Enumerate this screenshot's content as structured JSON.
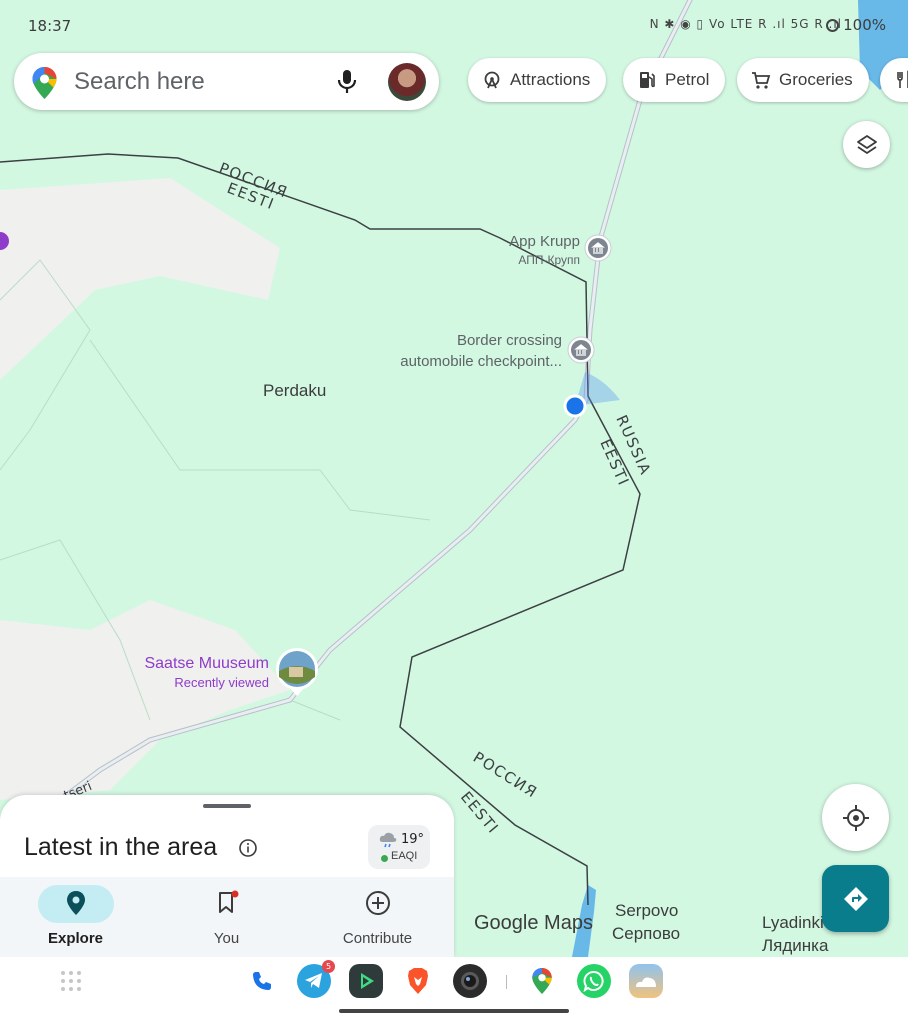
{
  "status_bar": {
    "time": "18:37",
    "icons_text": "N ✱ ◉ ▯ Vo LTE R .ıl 5G R .ıl",
    "battery": "100%"
  },
  "search": {
    "placeholder": "Search here"
  },
  "chips": [
    {
      "label": "Attractions",
      "icon": "ferris-wheel-icon"
    },
    {
      "label": "Petrol",
      "icon": "fuel-pump-icon"
    },
    {
      "label": "Groceries",
      "icon": "cart-icon"
    },
    {
      "label": "",
      "icon": "restaurant-icon"
    }
  ],
  "map": {
    "border_labels": {
      "russia_ru": "РОССИЯ",
      "estonia": "EESTI",
      "russia_en": "RUSSIA"
    },
    "places": {
      "perdaku": "Perdaku",
      "serpovo": "Serpovo",
      "serpovo_ru": "Серпово",
      "lyadinki": "Lyadinki",
      "lyadinki_ru": "Лядинка",
      "petseri_fragment": "tseri"
    },
    "pois": {
      "app_krupp": "App Krupp",
      "app_krupp_ru": "АПП-Крупп",
      "border_crossing_line1": "Border crossing",
      "border_crossing_line2": "automobile checkpoint...",
      "saatse": "Saatse Muuseum",
      "saatse_sub": "Recently viewed"
    },
    "watermark": "Google Maps"
  },
  "sheet": {
    "title": "Latest in the area",
    "weather_temp": "19°",
    "weather_aqi": "EAQI"
  },
  "nav": [
    {
      "label": "Explore",
      "active": true
    },
    {
      "label": "You",
      "active": false
    },
    {
      "label": "Contribute",
      "active": false
    }
  ],
  "dock": {
    "telegram_badge": "5"
  },
  "colors": {
    "map_green": "#d3f8e2",
    "map_gray": "#f0f0ef",
    "water": "#68b8e8",
    "accent_teal": "#0a7d8c",
    "location_blue": "#1a73e8",
    "poi_purple": "#8e3cc9"
  }
}
